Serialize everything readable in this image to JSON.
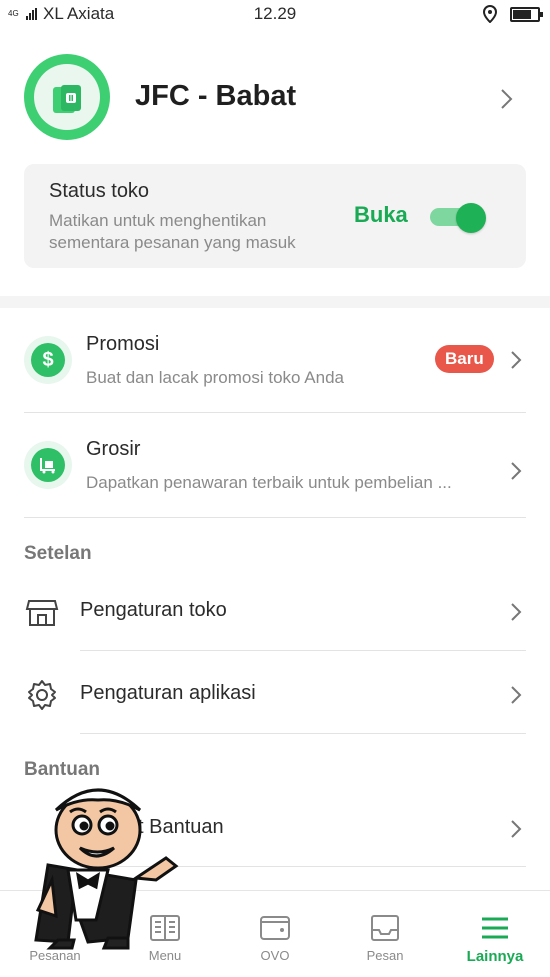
{
  "statusbar": {
    "network_type": "4G",
    "carrier": "XL Axiata",
    "time": "12.29"
  },
  "store": {
    "name": "JFC - Babat"
  },
  "store_status": {
    "title": "Status toko",
    "description": "Matikan untuk menghentikan sementara pesanan yang masuk",
    "state_label": "Buka",
    "toggle_on": true
  },
  "promotions": {
    "title": "Promosi",
    "subtitle": "Buat dan lacak promosi toko Anda",
    "badge": "Baru"
  },
  "wholesale": {
    "title": "Grosir",
    "subtitle": "Dapatkan penawaran terbaik untuk pembelian ..."
  },
  "settings": {
    "section_label": "Setelan",
    "store_settings": "Pengaturan toko",
    "app_settings": "Pengaturan aplikasi"
  },
  "help": {
    "section_label": "Bantuan",
    "item_label_visible": "t Bantuan"
  },
  "bottom_nav": {
    "items": [
      {
        "label": "Pesanan",
        "icon": "orders-icon",
        "active": false
      },
      {
        "label": "Menu",
        "icon": "menu-book-icon",
        "active": false
      },
      {
        "label": "OVO",
        "icon": "wallet-icon",
        "active": false
      },
      {
        "label": "Pesan",
        "icon": "inbox-icon",
        "active": false
      },
      {
        "label": "Lainnya",
        "icon": "hamburger-icon",
        "active": true
      }
    ]
  },
  "colors": {
    "brand_green": "#1aaa55",
    "badge_red": "#e8574a"
  }
}
